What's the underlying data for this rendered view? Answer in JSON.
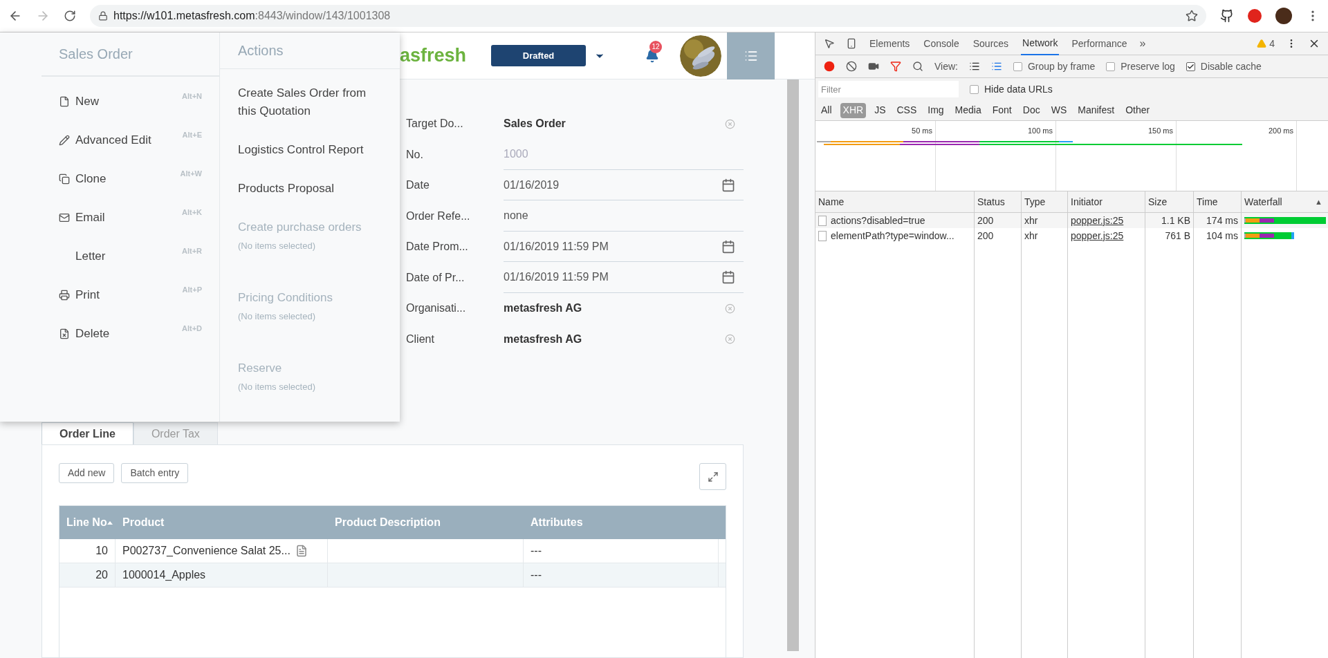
{
  "browser": {
    "url_host": "https://w101.metasfresh.com",
    "url_path": ":8443/window/143/1001308"
  },
  "header": {
    "logo": "asfresh",
    "status": "Drafted",
    "notifications": "12"
  },
  "menu": {
    "sections": [
      {
        "title": "Sales Order",
        "items": [
          {
            "label": "New",
            "shortcut": "Alt+N"
          },
          {
            "label": "Advanced Edit",
            "shortcut": "Alt+E"
          },
          {
            "label": "Clone",
            "shortcut": "Alt+W"
          },
          {
            "label": "Email",
            "shortcut": "Alt+K"
          },
          {
            "label": "Letter",
            "shortcut": "Alt+R"
          },
          {
            "label": "Print",
            "shortcut": "Alt+P"
          },
          {
            "label": "Delete",
            "shortcut": "Alt+D"
          }
        ]
      },
      {
        "title": "Actions",
        "actions": [
          {
            "label": "Create Sales Order from this Quotation",
            "disabled": false
          },
          {
            "label": "Logistics Control Report",
            "disabled": false
          },
          {
            "label": "Products Proposal",
            "disabled": false
          },
          {
            "label": "Create purchase orders",
            "note": "(No items selected)",
            "disabled": true
          },
          {
            "label": "Pricing Conditions",
            "note": "(No items selected)",
            "disabled": true
          },
          {
            "label": "Reserve",
            "note": "(No items selected)",
            "disabled": true
          }
        ]
      }
    ]
  },
  "form": {
    "fields": [
      {
        "label": "Target Do...",
        "value": "Sales Order",
        "kind": "lookup"
      },
      {
        "label": "No.",
        "value": "1000",
        "kind": "readonly"
      },
      {
        "label": "Date",
        "value": "01/16/2019",
        "kind": "date"
      },
      {
        "label": "Order Refe...",
        "value": "none",
        "kind": "text"
      },
      {
        "label": "Date Prom...",
        "value": "01/16/2019 11:59 PM",
        "kind": "date"
      },
      {
        "label": "Date of Pr...",
        "value": "01/16/2019 11:59 PM",
        "kind": "date"
      },
      {
        "label": "Organisati...",
        "value": "metasfresh AG",
        "kind": "lookup"
      },
      {
        "label": "Client",
        "value": "metasfresh AG",
        "kind": "lookup"
      }
    ]
  },
  "tabs": [
    {
      "label": "Order Line",
      "selected": true
    },
    {
      "label": "Order Tax",
      "selected": false
    }
  ],
  "buttons": [
    "Add new",
    "Batch entry"
  ],
  "table": {
    "columns": [
      "Line No",
      "Product",
      "Product Description",
      "Attributes"
    ],
    "rows": [
      {
        "cells": [
          "10",
          "P002737_Convenience Salat 25...",
          "",
          "---"
        ]
      },
      {
        "cells": [
          "20",
          "1000014_Apples",
          "",
          "---"
        ]
      }
    ]
  },
  "devtools": {
    "tabs": [
      {
        "label": "Elements",
        "selected": false
      },
      {
        "label": "Console",
        "selected": false
      },
      {
        "label": "Sources",
        "selected": false
      },
      {
        "label": "Network",
        "selected": true
      },
      {
        "label": "Performance",
        "selected": false
      }
    ],
    "more": "»",
    "warnings": "4",
    "view_label": "View:",
    "options": [
      {
        "label": "Group by frame",
        "checked": false
      },
      {
        "label": "Preserve log",
        "checked": false
      },
      {
        "label": "Disable cache",
        "checked": true
      }
    ],
    "filter_placeholder": "Filter",
    "hide_data_urls": {
      "label": "Hide data URLs",
      "checked": false
    },
    "types": [
      {
        "label": "All",
        "selected": false
      },
      {
        "label": "XHR",
        "selected": true
      },
      {
        "label": "JS",
        "selected": false
      },
      {
        "label": "CSS",
        "selected": false
      },
      {
        "label": "Img",
        "selected": false
      },
      {
        "label": "Media",
        "selected": false
      },
      {
        "label": "Font",
        "selected": false
      },
      {
        "label": "Doc",
        "selected": false
      },
      {
        "label": "WS",
        "selected": false
      },
      {
        "label": "Manifest",
        "selected": false
      },
      {
        "label": "Other",
        "selected": false
      }
    ],
    "ticks": [
      "50 ms",
      "100 ms",
      "150 ms",
      "200 ms"
    ],
    "columns": [
      "Name",
      "Status",
      "Type",
      "Initiator",
      "Size",
      "Time",
      "Waterfall"
    ],
    "sort_mark": "▲",
    "requests": [
      {
        "name": "actions?disabled=true",
        "status": "200",
        "type": "xhr",
        "initiator": "popper.js:25",
        "size": "1.1 KB",
        "time": "174 ms"
      },
      {
        "name": "elementPath?type=window...",
        "status": "200",
        "type": "xhr",
        "initiator": "popper.js:25",
        "size": "761 B",
        "time": "104 ms"
      }
    ]
  }
}
